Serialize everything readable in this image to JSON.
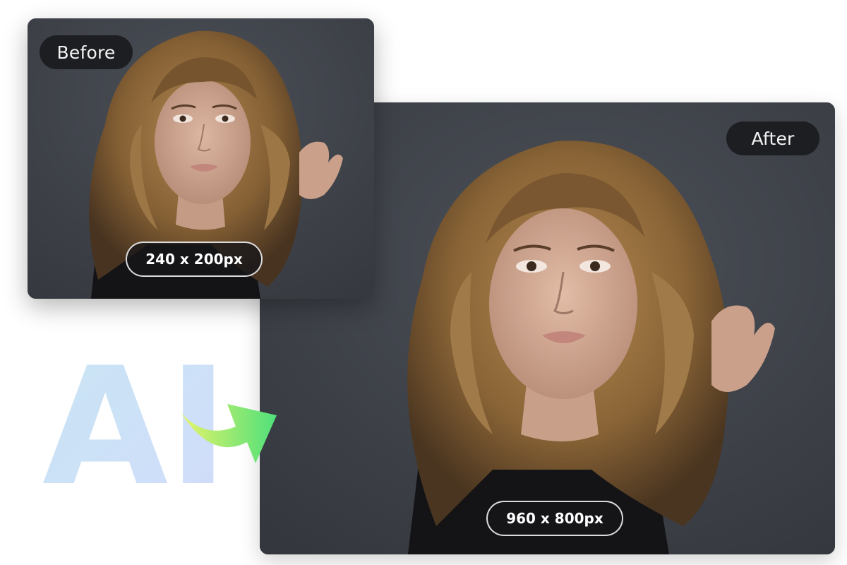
{
  "before": {
    "label": "Before",
    "size": "240 x 200px"
  },
  "after": {
    "label": "After",
    "size": "960 x 800px"
  },
  "watermark": {
    "text": "AI"
  },
  "colors": {
    "photo_background": "#3a3d44",
    "label_pill": "#18191d",
    "arrow_start": "#e6f46a",
    "arrow_end": "#4fe07a",
    "ai_start": "#b8ddf4",
    "ai_end": "#cbd8fb"
  },
  "icons": {
    "transform_arrow": "curved-arrow-icon"
  }
}
